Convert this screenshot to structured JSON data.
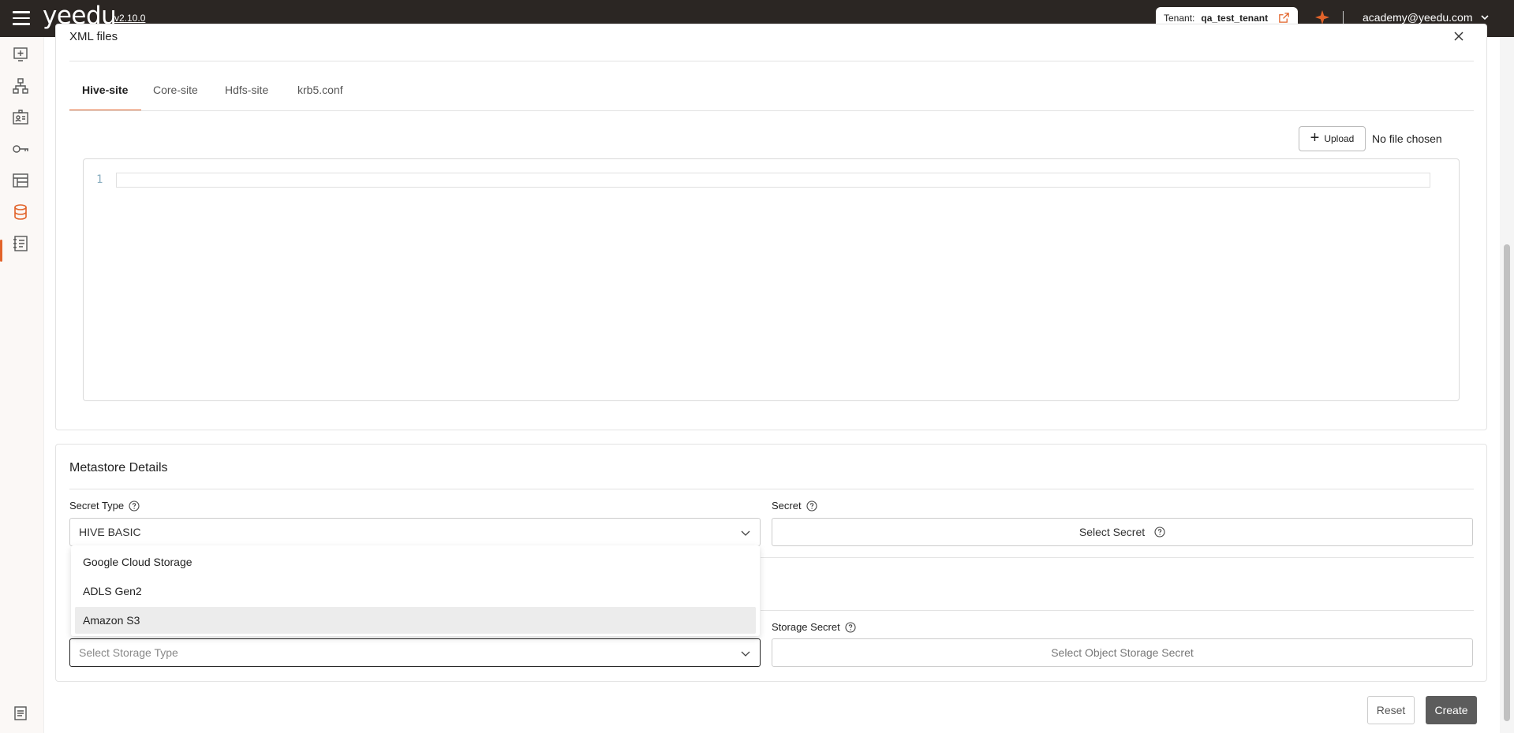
{
  "header": {
    "brand": "yeedu",
    "version": "v2.10.0",
    "tenant_label": "Tenant:",
    "tenant_name": "qa_test_tenant",
    "user_email": "academy@yeedu.com",
    "accent_color": "#e2632a"
  },
  "sidebar": {
    "items": [
      {
        "icon": "add-screen-icon"
      },
      {
        "icon": "hierarchy-icon"
      },
      {
        "icon": "id-card-icon"
      },
      {
        "icon": "key-icon"
      },
      {
        "icon": "workspace-icon"
      },
      {
        "icon": "database-icon",
        "active": true
      },
      {
        "icon": "notebook-icon"
      }
    ],
    "footer_icon": "document-icon"
  },
  "xml_files": {
    "title": "XML files",
    "tabs": [
      {
        "label": "Hive-site",
        "active": true
      },
      {
        "label": "Core-site"
      },
      {
        "label": "Hdfs-site"
      },
      {
        "label": "krb5.conf"
      }
    ],
    "upload_label": "Upload",
    "no_file_text": "No file chosen",
    "editor_line_number": "1"
  },
  "metastore": {
    "title": "Metastore Details",
    "secret_type_label": "Secret Type",
    "secret_type_value": "HIVE BASIC",
    "secret_label": "Secret",
    "secret_button": "Select Secret",
    "storage_type_placeholder": "Select Storage Type",
    "storage_secret_label": "Storage Secret",
    "storage_secret_button": "Select Object Storage Secret",
    "dropdown_options": [
      "Google Cloud Storage",
      "ADLS Gen2",
      "Amazon S3"
    ],
    "hovered_option": "Amazon S3"
  },
  "footer": {
    "reset_label": "Reset",
    "create_label": "Create"
  }
}
